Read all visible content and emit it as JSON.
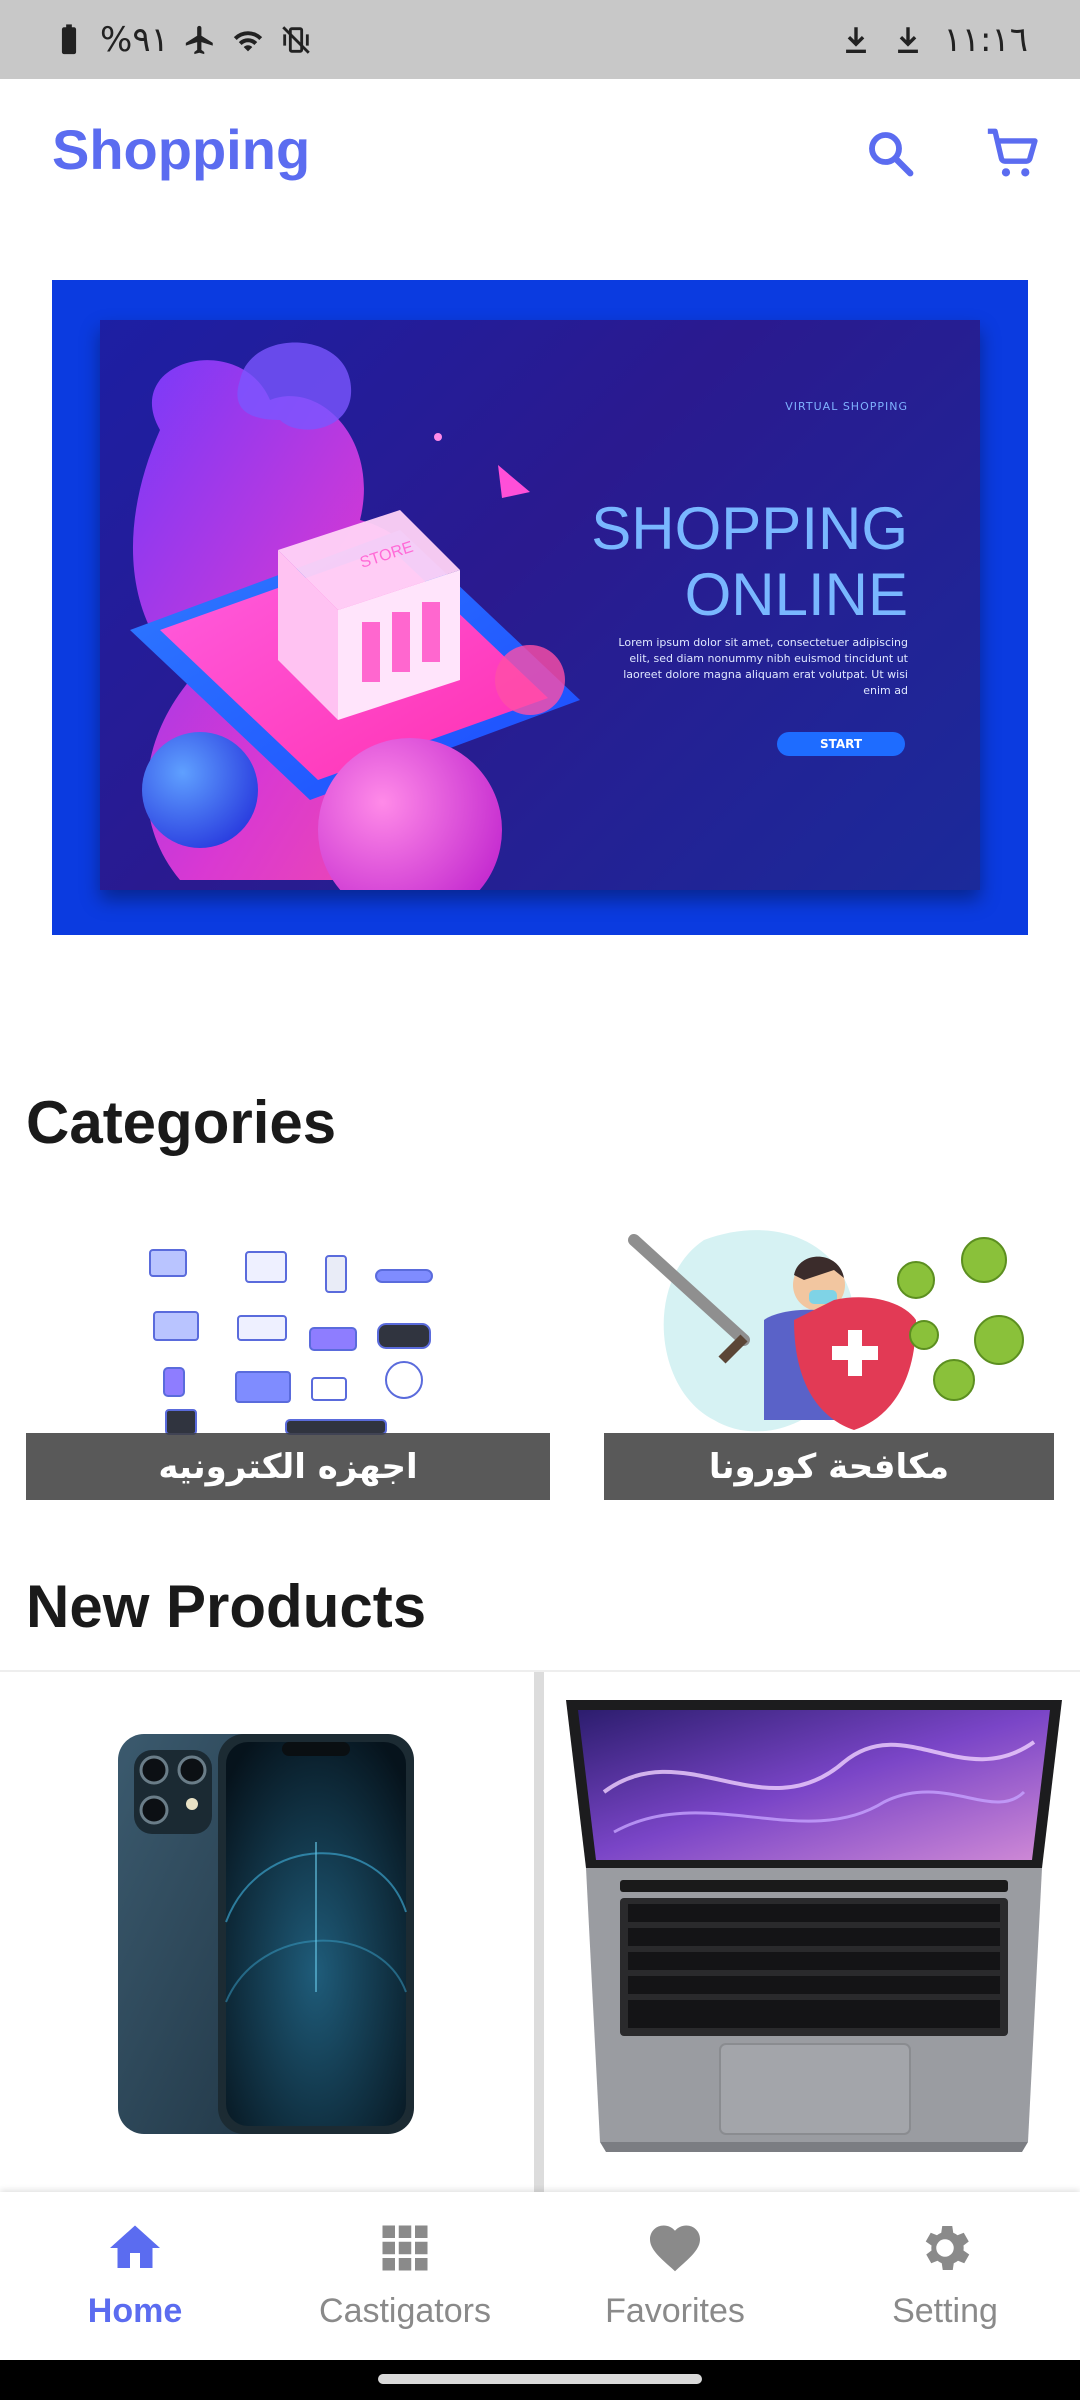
{
  "status_bar": {
    "battery_text": "%٩١",
    "time": "١١:١٦"
  },
  "app_bar": {
    "title": "Shopping",
    "search_icon": "search-icon",
    "cart_icon": "cart-icon"
  },
  "banner": {
    "small_label": "VIRTUAL SHOPPING",
    "headline_line1": "SHOPPING",
    "headline_line2": "ONLINE",
    "body_text": "Lorem ipsum dolor sit amet, consectetuer adipiscing elit, sed diam nonummy nibh euismod tincidunt ut laoreet dolore magna aliquam erat volutpat. Ut wisi enim ad",
    "cta": "START",
    "store_sign": "STORE"
  },
  "categories": {
    "title": "Categories",
    "items": [
      {
        "label": "اجهزه الكترونيه",
        "icon": "electronics-illustration"
      },
      {
        "label": "مكافحة كورونا",
        "icon": "anti-corona-illustration"
      }
    ]
  },
  "new_products": {
    "title": "New Products",
    "items": [
      {
        "icon": "smartphone-image"
      },
      {
        "icon": "laptop-image"
      }
    ]
  },
  "bottom_nav": {
    "items": [
      {
        "label": "Home",
        "icon": "home-icon",
        "active": true
      },
      {
        "label": "Castigators",
        "icon": "grid-icon",
        "active": false
      },
      {
        "label": "Favorites",
        "icon": "heart-icon",
        "active": false
      },
      {
        "label": "Setting",
        "icon": "gear-icon",
        "active": false
      }
    ]
  },
  "colors": {
    "accent": "#5b6cf0",
    "banner_bg": "#0b3be0",
    "inactive": "#8a8a8a"
  }
}
